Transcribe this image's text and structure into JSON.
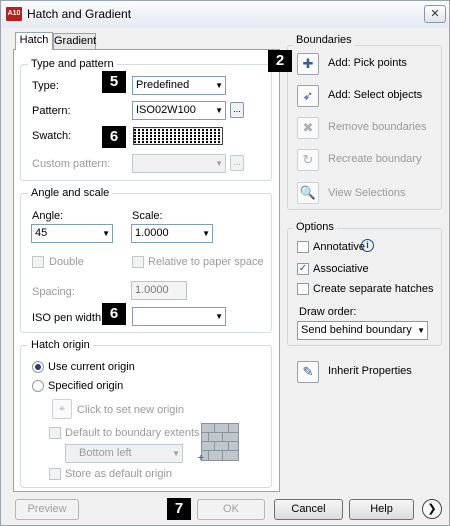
{
  "window": {
    "title": "Hatch and Gradient",
    "close_glyph": "✕",
    "app_icon_text": "A10"
  },
  "tabs": [
    {
      "label": "Hatch"
    },
    {
      "label": "Gradient"
    }
  ],
  "type_and_pattern": {
    "group_title": "Type and pattern",
    "type_label": "Type:",
    "type_value": "Predefined",
    "pattern_label": "Pattern:",
    "pattern_value": "ISO02W100",
    "swatch_label": "Swatch:",
    "custom_pattern_label": "Custom pattern:",
    "custom_pattern_value": ""
  },
  "angle_and_scale": {
    "group_title": "Angle and scale",
    "angle_label": "Angle:",
    "angle_value": "45",
    "scale_label": "Scale:",
    "scale_value": "1.0000",
    "double_label": "Double",
    "double_checked": false,
    "relative_label": "Relative to paper space",
    "relative_checked": false,
    "spacing_label": "Spacing:",
    "spacing_value": "1.0000",
    "iso_pen_label": "ISO pen width:",
    "iso_pen_value": ""
  },
  "hatch_origin": {
    "group_title": "Hatch origin",
    "use_current_label": "Use current origin",
    "use_current_selected": true,
    "specified_label": "Specified origin",
    "specified_selected": false,
    "click_to_set_label": "Click to set new origin",
    "default_extents_label": "Default to boundary extents",
    "default_extents_checked": false,
    "position_value": "Bottom left",
    "store_default_label": "Store as default origin",
    "store_default_checked": false
  },
  "boundaries": {
    "group_title": "Boundaries",
    "items": [
      {
        "label": "Add: Pick points",
        "icon": "pick-points-icon",
        "glyph": "✚",
        "enabled": true
      },
      {
        "label": "Add: Select objects",
        "icon": "select-objects-icon",
        "glyph": "➶",
        "enabled": true
      },
      {
        "label": "Remove boundaries",
        "icon": "remove-boundaries-icon",
        "glyph": "✖",
        "enabled": false
      },
      {
        "label": "Recreate boundary",
        "icon": "recreate-boundary-icon",
        "glyph": "↻",
        "enabled": false
      },
      {
        "label": "View Selections",
        "icon": "magnifier-icon",
        "glyph": "🔍",
        "enabled": false
      }
    ]
  },
  "options": {
    "group_title": "Options",
    "annotative_label": "Annotative",
    "annotative_checked": false,
    "info_glyph": "i",
    "associative_label": "Associative",
    "associative_checked": true,
    "separate_label": "Create separate hatches",
    "separate_checked": false,
    "draw_order_label": "Draw order:",
    "draw_order_value": "Send behind boundary"
  },
  "inherit": {
    "label": "Inherit Properties",
    "icon": "inherit-properties-icon",
    "glyph": "✎"
  },
  "footer": {
    "preview_label": "Preview",
    "ok_label": "OK",
    "cancel_label": "Cancel",
    "help_label": "Help",
    "more_glyph": "❯"
  },
  "callouts": [
    "2",
    "5",
    "6",
    "6",
    "7"
  ],
  "colors": {
    "accent": "#3399ff",
    "callout_bg": "#000000",
    "window_bg": "#f0f0f0"
  }
}
